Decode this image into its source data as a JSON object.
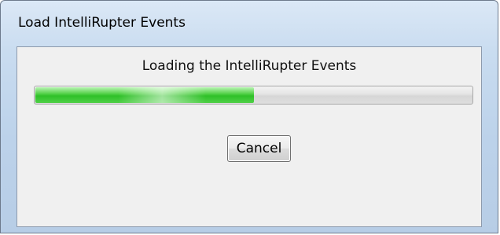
{
  "window": {
    "title": "Load IntelliRupter Events"
  },
  "dialog": {
    "message": "Loading the IntelliRupter Events",
    "progress_fraction": 0.5,
    "cancel_label": "Cancel"
  },
  "colors": {
    "progress_fill": "#2fc028",
    "titlebar": "#c9dcf0",
    "client_background": "#f0f0f0"
  }
}
